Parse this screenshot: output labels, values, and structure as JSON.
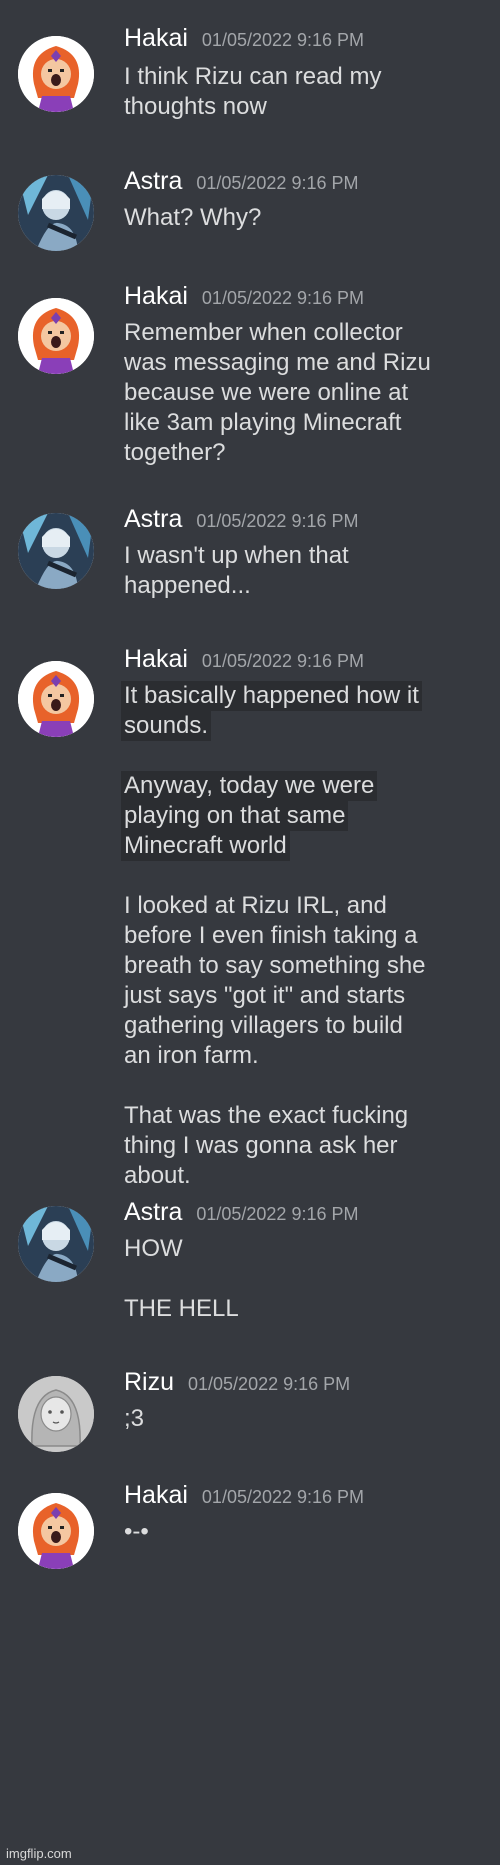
{
  "messages": [
    {
      "author": "Hakai",
      "timestamp": "01/05/2022 9:16 PM",
      "avatar": "hakai-avatar",
      "lines": [
        "I think Rizu can read my",
        "thoughts now"
      ]
    },
    {
      "author": "Astra",
      "timestamp": "01/05/2022 9:16 PM",
      "avatar": "astra-avatar",
      "lines": [
        "What? Why?"
      ]
    },
    {
      "author": "Hakai",
      "timestamp": "01/05/2022 9:16 PM",
      "avatar": "hakai-avatar",
      "lines": [
        "Remember when collector",
        "was messaging me and Rizu",
        "because we were online at",
        "like 3am playing Minecraft",
        "together?"
      ]
    },
    {
      "author": "Astra",
      "timestamp": "01/05/2022 9:16 PM",
      "avatar": "astra-avatar",
      "lines": [
        "I wasn't up when that",
        "happened..."
      ]
    },
    {
      "author": "Hakai",
      "timestamp": "01/05/2022 9:16 PM",
      "avatar": "hakai-avatar",
      "paragraphs": [
        [
          "It basically happened how it",
          "sounds."
        ],
        [
          "Anyway, today we were",
          "playing on that same",
          "Minecraft world"
        ],
        [
          "I looked at Rizu IRL, and",
          "before I even finish taking a",
          "breath to say something she",
          "just says \"got it\" and starts",
          "gathering villagers to build",
          "an iron farm."
        ],
        [
          "That was the exact fucking",
          "thing I was gonna ask her",
          "about."
        ]
      ]
    },
    {
      "author": "Astra",
      "timestamp": "01/05/2022 9:16 PM",
      "avatar": "astra-avatar",
      "paragraphs": [
        [
          "HOW"
        ],
        [
          "THE HELL"
        ]
      ]
    },
    {
      "author": "Rizu",
      "timestamp": "01/05/2022 9:16 PM",
      "avatar": "rizu-avatar",
      "lines": [
        ";3"
      ]
    },
    {
      "author": "Hakai",
      "timestamp": "01/05/2022 9:16 PM",
      "avatar": "hakai-avatar",
      "lines": [
        "•-•"
      ]
    }
  ],
  "watermark": "imgflip.com"
}
